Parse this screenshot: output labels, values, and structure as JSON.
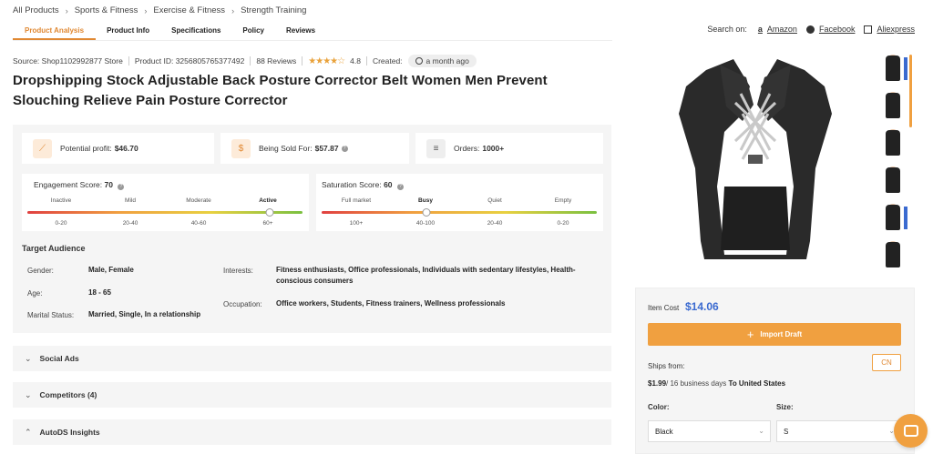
{
  "breadcrumb": [
    "All Products",
    "Sports & Fitness",
    "Exercise & Fitness",
    "Strength Training"
  ],
  "tabs": [
    "Product Analysis",
    "Product Info",
    "Specifications",
    "Policy",
    "Reviews"
  ],
  "search_on": {
    "label": "Search on:",
    "links": [
      "Amazon",
      "Facebook",
      "Aliexpress"
    ]
  },
  "meta": {
    "source": "Source: Shop1102992877 Store",
    "product_id": "Product ID: 3256805765377492",
    "reviews": "88 Reviews",
    "rating": "4.8",
    "created_label": "Created:",
    "created_value": "a month ago"
  },
  "title": "Dropshipping Stock Adjustable Back Posture Corrector Belt Women Men Prevent Slouching Relieve Pain Posture Corrector",
  "stats": {
    "potential_profit_label": "Potential profit:",
    "potential_profit": "$46.70",
    "sold_for_label": "Being Sold For:",
    "sold_for": "$57.87",
    "orders_label": "Orders:",
    "orders": "1000+"
  },
  "engagement": {
    "label": "Engagement Score:",
    "score": "70",
    "levels": [
      "Inactive",
      "Mild",
      "Moderate",
      "Active"
    ],
    "ranges": [
      "0-20",
      "20-40",
      "40-60",
      "60+"
    ],
    "level_value": 0.88
  },
  "saturation": {
    "label": "Saturation Score:",
    "score": "60",
    "levels": [
      "Full market",
      "Busy",
      "Quiet",
      "Empty"
    ],
    "ranges": [
      "100+",
      "40-100",
      "20-40",
      "0-20"
    ],
    "level_value": 0.38
  },
  "target_audience": {
    "heading": "Target Audience",
    "gender_label": "Gender:",
    "gender": "Male, Female",
    "age_label": "Age:",
    "age": "18 - 65",
    "marital_label": "Marital Status:",
    "marital": "Married, Single, In a relationship",
    "interests_label": "Interests:",
    "interests": "Fitness enthusiasts, Office professionals, Individuals with sedentary lifestyles, Health-conscious consumers",
    "occupation_label": "Occupation:",
    "occupation": "Office workers, Students, Fitness trainers, Wellness professionals"
  },
  "sections": [
    "Social Ads",
    "Competitors (4)",
    "AutoDS Insights"
  ],
  "buy": {
    "item_cost_label": "Item Cost",
    "item_cost": "$14.06",
    "import_label": "Import Draft",
    "ships_from_label": "Ships from:",
    "ships_from_value": "CN",
    "ship_price": "$1.99",
    "ship_days": "/ 16 business days",
    "ship_dest": "To United States",
    "color_label": "Color:",
    "color_value": "Black",
    "size_label": "Size:",
    "size_value": "S"
  },
  "colors": {
    "accent": "#e08832",
    "price": "#3a6ad0"
  }
}
